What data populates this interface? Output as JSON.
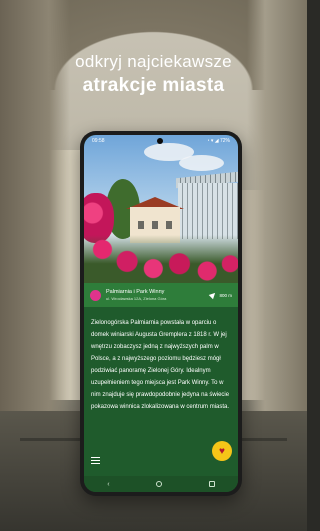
{
  "headline": {
    "line1": "odkryj najciekawsze",
    "line2": "atrakcje miasta"
  },
  "statusbar": {
    "time": "09:58",
    "right": "◔ ▾ ◢ 72%"
  },
  "place": {
    "name": "Palmiarnia i Park Winny",
    "address": "ul. Wrocławska 12A, Zielona Góra",
    "distance": "800 m",
    "pin_color": "#e0338c"
  },
  "description": "Zielonogórska Palmiarnia powstała w oparciu o domek winiarski Augusta Gremplera z 1818 r. W jej wnętrzu zobaczysz jedną z najwyższych palm w Polsce, a z najwyższego poziomu będziesz mógł podziwiać panoramę Zielonej Góry. Idealnym uzupełnieniem tego miejsca jest Park Winny. To w nim znajduje się prawdopodobnie jedyna na świecie pokazowa winnica zlokalizowana w centrum miasta.",
  "icons": {
    "menu": "hamburger-icon",
    "favorite": "heart-icon",
    "navigate": "navigation-arrow-icon",
    "back": "back-icon",
    "home": "home-icon",
    "recent": "recent-apps-icon"
  },
  "colors": {
    "app_green": "#2e7d3a",
    "screen_green": "#1f5b2c",
    "fav_yellow": "#f5c518"
  },
  "navbar": {
    "back": "‹"
  }
}
